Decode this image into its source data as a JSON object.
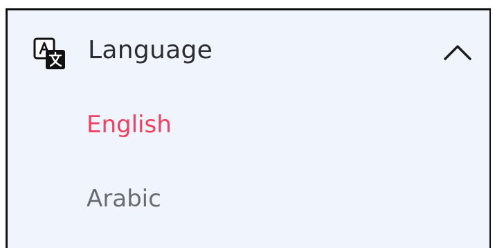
{
  "header": {
    "icon": "translate-icon",
    "label": "Language",
    "chevron": "chevron-up-icon",
    "expanded": true
  },
  "options": [
    {
      "label": "English",
      "selected": true,
      "color": "#f43f61"
    },
    {
      "label": "Arabic",
      "selected": false,
      "color": "#6b6b70"
    }
  ],
  "colors": {
    "panel_background": "#eff4fd",
    "text": "#2c2c31",
    "accent": "#f43f61"
  }
}
